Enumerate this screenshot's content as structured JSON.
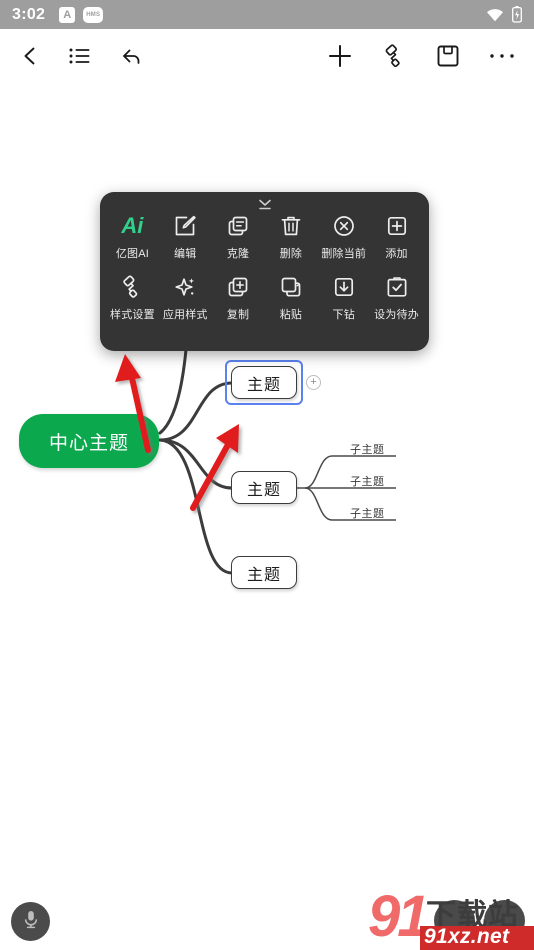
{
  "status_bar": {
    "time": "3:02",
    "icons": [
      {
        "name": "a-badge-icon",
        "label": "A"
      },
      {
        "name": "hms-badge-icon",
        "label": "HMS"
      },
      {
        "name": "wifi-icon",
        "label": "wifi"
      },
      {
        "name": "battery-icon",
        "label": "battery"
      }
    ],
    "background": "#9e9e9e"
  },
  "toolbar": {
    "left": [
      {
        "name": "back-button",
        "icon": "chevron-left-icon"
      },
      {
        "name": "outline-button",
        "icon": "list-icon"
      },
      {
        "name": "undo-button",
        "icon": "undo-arrow-icon"
      }
    ],
    "right": [
      {
        "name": "add-button",
        "icon": "plus-icon"
      },
      {
        "name": "style-brush-button",
        "icon": "paint-roller-icon"
      },
      {
        "name": "save-button",
        "icon": "floppy-disk-icon"
      },
      {
        "name": "more-button",
        "icon": "ellipsis-icon"
      }
    ]
  },
  "context_menu": {
    "background": "#343434",
    "collapse_handle": "chevron-down-icon",
    "row1": [
      {
        "label": "亿图AI",
        "icon": "ai-icon",
        "accent": "#2fd18b"
      },
      {
        "label": "编辑",
        "icon": "edit-pencil-icon"
      },
      {
        "label": "克隆",
        "icon": "clone-icon"
      },
      {
        "label": "删除",
        "icon": "trash-icon"
      },
      {
        "label": "删除当前",
        "icon": "circle-x-icon"
      },
      {
        "label": "添加",
        "icon": "plus-square-icon"
      }
    ],
    "row2": [
      {
        "label": "样式设置",
        "icon": "paint-roller-icon"
      },
      {
        "label": "应用样式",
        "icon": "sparkle-icon"
      },
      {
        "label": "复制",
        "icon": "copy-plus-icon"
      },
      {
        "label": "粘贴",
        "icon": "paste-icon"
      },
      {
        "label": "下钻",
        "icon": "drill-down-icon"
      },
      {
        "label": "设为待办",
        "icon": "clipboard-check-icon"
      }
    ]
  },
  "mindmap": {
    "central": {
      "label": "中心主题",
      "color": "#0ba84e",
      "text_color": "#ffffff"
    },
    "topics": [
      {
        "label": "主题",
        "selected": true,
        "add_badge": "+"
      },
      {
        "label": "主题",
        "selected": false
      },
      {
        "label": "主题",
        "selected": false
      }
    ],
    "subtopics": [
      {
        "label": "子主题"
      },
      {
        "label": "子主题"
      },
      {
        "label": "子主题"
      }
    ],
    "selection_color": "#5b82f0",
    "link_color": "#3c3c3c"
  },
  "annotations": {
    "arrow_color": "#e01b1b",
    "arrows": [
      {
        "name": "annotation-arrow-to-style-settings"
      },
      {
        "name": "annotation-arrow-to-topic"
      }
    ]
  },
  "bottom": {
    "mic_button": {
      "name": "voice-input-button",
      "icon": "microphone-icon"
    },
    "fab_one": {
      "name": "floating-action-button-one"
    },
    "fab_two": {
      "name": "floating-action-button-two"
    }
  },
  "watermark": {
    "number": "91",
    "cn": "下载站",
    "url": "91xz.net"
  }
}
